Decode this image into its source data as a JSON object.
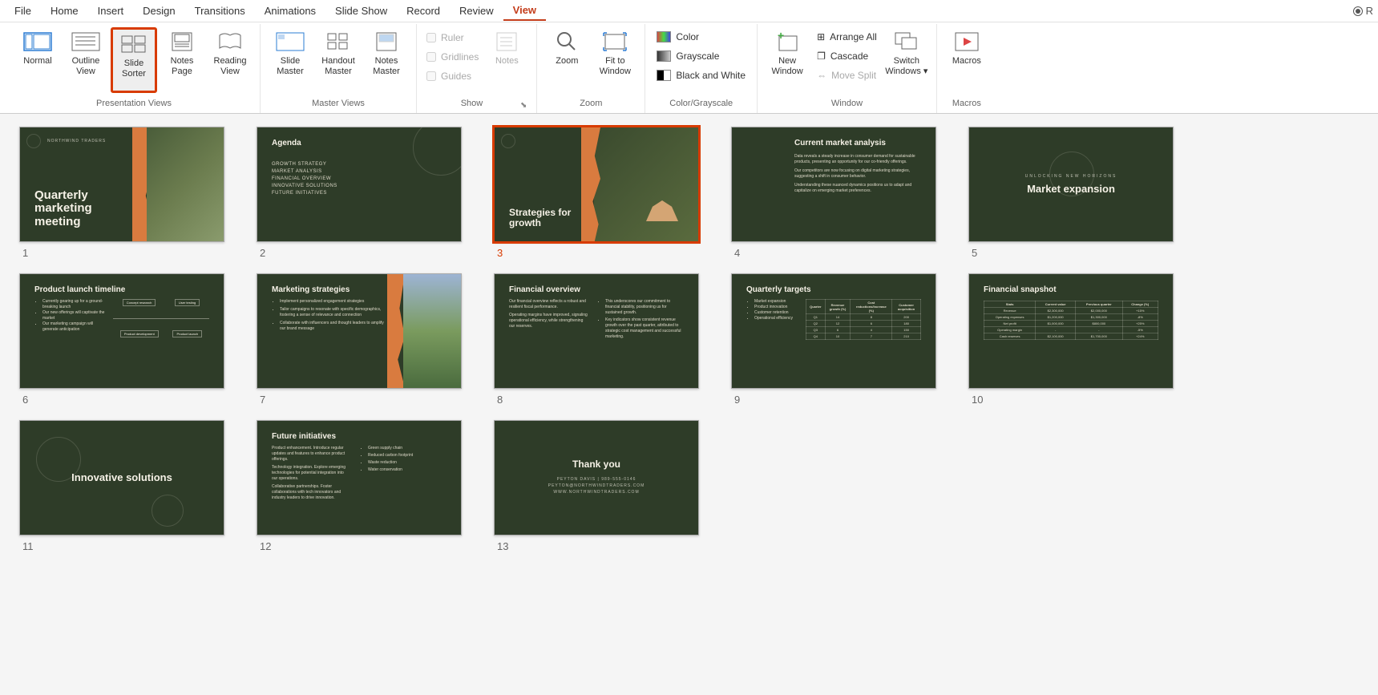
{
  "menubar": {
    "tabs": [
      "File",
      "Home",
      "Insert",
      "Design",
      "Transitions",
      "Animations",
      "Slide Show",
      "Record",
      "Review",
      "View"
    ],
    "active": "View",
    "right_label": "R"
  },
  "ribbon": {
    "presentation_views": {
      "label": "Presentation Views",
      "normal": "Normal",
      "outline": "Outline\nView",
      "sorter": "Slide\nSorter",
      "notes_page": "Notes\nPage",
      "reading": "Reading\nView"
    },
    "master_views": {
      "label": "Master Views",
      "slide_master": "Slide\nMaster",
      "handout_master": "Handout\nMaster",
      "notes_master": "Notes\nMaster"
    },
    "show": {
      "label": "Show",
      "ruler": "Ruler",
      "gridlines": "Gridlines",
      "guides": "Guides",
      "notes": "Notes"
    },
    "zoom": {
      "label": "Zoom",
      "zoom": "Zoom",
      "fit": "Fit to\nWindow"
    },
    "color": {
      "label": "Color/Grayscale",
      "color": "Color",
      "grayscale": "Grayscale",
      "bw": "Black and White"
    },
    "window": {
      "label": "Window",
      "new_window": "New\nWindow",
      "arrange": "Arrange All",
      "cascade": "Cascade",
      "move_split": "Move Split",
      "switch": "Switch\nWindows"
    },
    "macros": {
      "label": "Macros",
      "macros": "Macros"
    }
  },
  "slides": [
    {
      "num": "1",
      "title": "Quarterly marketing meeting",
      "brand": "NORTHWIND TRADERS",
      "type": "title_orange_photo"
    },
    {
      "num": "2",
      "title": "Agenda",
      "items": [
        "GROWTH STRATEGY",
        "MARKET ANALYSIS",
        "FINANCIAL OVERVIEW",
        "INNOVATIVE SOLUTIONS",
        "FUTURE INITIATIVES"
      ],
      "type": "agenda"
    },
    {
      "num": "3",
      "title": "Strategies for growth",
      "type": "title_orange_photo_right",
      "selected": true
    },
    {
      "num": "4",
      "title": "Current market analysis",
      "body": [
        "Data reveals a steady increase in consumer demand for sustainable products, presenting an opportunity for our co-friendly offerings.",
        "Our competitors are now focusing on digital marketing strategies, suggesting a shift in consumer behavior.",
        "Understanding these nuanced dynamics positions us to adapt and capitalize on emerging market preferences."
      ],
      "type": "text"
    },
    {
      "num": "5",
      "title": "Market expansion",
      "sub": "UNLOCKING NEW HORIZONS",
      "type": "section"
    },
    {
      "num": "6",
      "title": "Product launch timeline",
      "bullets": [
        "Currently gearing up for a ground-breaking launch",
        "Our new offerings will captivate the market",
        "Our marketing campaign will generate anticipation"
      ],
      "type": "timeline"
    },
    {
      "num": "7",
      "title": "Marketing strategies",
      "bullets": [
        "Implement personalized engagement strategies",
        "Tailor campaigns to resonate with specific demographics, fostering a sense of relevance and connection",
        "Collaborate with influencers and thought leaders to amplify our brand message"
      ],
      "type": "bullets_photo"
    },
    {
      "num": "8",
      "title": "Financial overview",
      "left": [
        "Our financial overview reflects a robust and resilient fiscal performance.",
        "Operating margins have improved, signaling operational efficiency, while strengthening our reserves."
      ],
      "right": [
        "This underscores our commitment to financial stability, positioning us for sustained growth.",
        "Key indicators show consistent revenue growth over the past quarter, attributed to strategic cost management and successful marketing."
      ],
      "type": "two_col"
    },
    {
      "num": "9",
      "title": "Quarterly targets",
      "bullets": [
        "Market expansion",
        "Product innovation",
        "Customer retention",
        "Operational efficiency"
      ],
      "table": {
        "headers": [
          "Quarter",
          "Revenue growth (%)",
          "Cost reductions/Increase (%)",
          "Customer acquisition"
        ],
        "rows": [
          [
            "Q1",
            "14",
            "8",
            "200"
          ],
          [
            "Q2",
            "12",
            "6",
            "180"
          ],
          [
            "Q3",
            "6",
            "4",
            "150"
          ],
          [
            "Q4",
            "10",
            "7",
            "210"
          ]
        ]
      },
      "type": "bullets_table"
    },
    {
      "num": "10",
      "title": "Financial snapshot",
      "table": {
        "headers": [
          "Stats",
          "Current value",
          "Previous quarter",
          "Change (%)"
        ],
        "rows": [
          [
            "Revenue",
            "$2,300,000",
            "$2,000,000",
            "+15%"
          ],
          [
            "Operating expenses",
            "$1,200,000",
            "$1,300,000",
            "-8%"
          ],
          [
            "Net profit",
            "$1,000,000",
            "$800,000",
            "+25%"
          ],
          [
            "Operating margin",
            "-",
            "-",
            "-5%"
          ],
          [
            "Cash reserves",
            "$2,100,000",
            "$1,700,000",
            "+24%"
          ]
        ]
      },
      "type": "table_only"
    },
    {
      "num": "11",
      "title": "Innovative solutions",
      "type": "section_plain"
    },
    {
      "num": "12",
      "title": "Future initiatives",
      "left": [
        "Product enhancement. Introduce regular updates and features to enhance product offerings.",
        "Technology integration. Explore emerging technologies for potential integration into our operations.",
        "Collaborative partnerships. Foster collaborations with tech innovators and industry leaders to drive innovation."
      ],
      "right": [
        "Green supply chain",
        "Reduced carbon footprint",
        "Waste reduction",
        "Water conservation"
      ],
      "type": "two_col"
    },
    {
      "num": "13",
      "title": "Thank you",
      "contact": [
        "PEYTON DAVIS | 989-555-0146",
        "PEYTON@NORTHWINDTRADERS.COM",
        "WWW.NORTHWINDTRADERS.COM"
      ],
      "type": "thankyou"
    }
  ]
}
